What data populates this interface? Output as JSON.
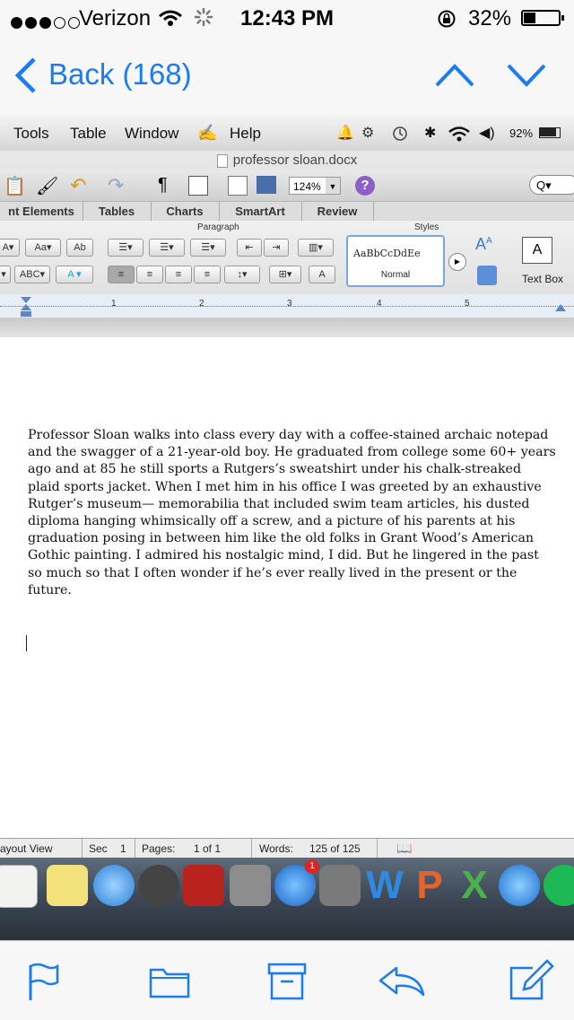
{
  "status_bar": {
    "carrier": "Verizon",
    "time": "12:43 PM",
    "battery": "32%"
  },
  "nav": {
    "back_label": "Back (168)"
  },
  "mac": {
    "menu": [
      "Tools",
      "Table",
      "Window",
      "Help"
    ],
    "menubar_battery": "92%",
    "doc_title": "professor sloan.docx",
    "zoom": "124%",
    "ribbon_tabs": [
      "nt Elements",
      "Tables",
      "Charts",
      "SmartArt",
      "Review"
    ],
    "groups": {
      "paragraph": "Paragraph",
      "styles": "Styles"
    },
    "style_preview": "AaBbCcDdEe",
    "style_name": "Normal",
    "textbox_label": "Text Box",
    "ruler_marks": [
      "1",
      "2",
      "3",
      "4",
      "5"
    ],
    "body_text": "Professor Sloan walks into class every day with a coffee-stained archaic notepad and the swagger of a 21-year-old boy. He graduated from college some 60+ years ago and at 85 he still sports a Rutgers’s sweatshirt under his chalk-streaked plaid sports jacket. When I met him in his office I was greeted by an exhaustive Rutger’s museum— memorabilia that included swim team articles, his dusted diploma hanging whimsically off a screw, and a picture of his parents at his graduation posing in between him like the old folks in Grant Wood’s American Gothic painting. I admired his nostalgic mind, I did. But he lingered in the past so much so that I often wonder if he’s ever really lived in the present or the future.",
    "statusbar": {
      "view": "ayout View",
      "sec_label": "Sec",
      "sec_value": "1",
      "pages_label": "Pages:",
      "pages_value": "1 of 1",
      "words_label": "Words:",
      "words_value": "125 of 125"
    },
    "dock_badge": "1"
  },
  "colors": {
    "ios_blue": "#1a7cf5"
  }
}
